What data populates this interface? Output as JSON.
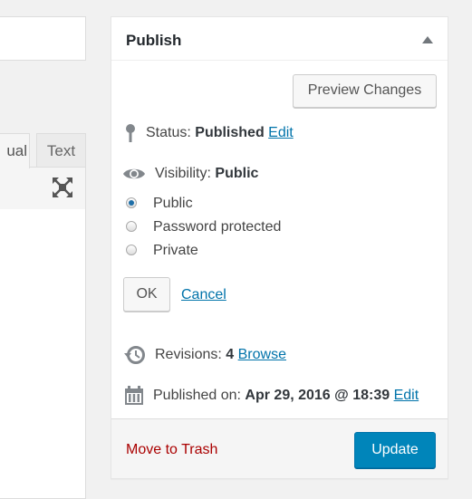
{
  "editor": {
    "tab_visual": "ual",
    "tab_text": "Text",
    "fullscreen_icon": "fullscreen-icon"
  },
  "publish": {
    "title": "Publish",
    "preview_label": "Preview Changes",
    "status_label": "Status:",
    "status_value": "Published",
    "status_edit": "Edit",
    "visibility_label": "Visibility:",
    "visibility_value": "Public",
    "visibility_options": [
      {
        "label": "Public",
        "checked": true
      },
      {
        "label": "Password protected",
        "checked": false
      },
      {
        "label": "Private",
        "checked": false
      }
    ],
    "ok_label": "OK",
    "cancel_label": "Cancel",
    "revisions_label": "Revisions:",
    "revisions_count": "4",
    "revisions_browse": "Browse",
    "published_label": "Published on:",
    "published_value": "Apr 29, 2016 @ 18:39",
    "published_edit": "Edit",
    "trash_label": "Move to Trash",
    "update_label": "Update"
  },
  "colors": {
    "accent": "#0085ba",
    "link": "#0073aa",
    "danger": "#aa0000"
  }
}
